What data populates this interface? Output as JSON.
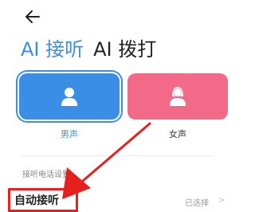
{
  "header": {
    "back_icon": "arrow-left-icon"
  },
  "tabs": [
    {
      "label": "AI 接听",
      "active": true
    },
    {
      "label": "AI 拨打",
      "active": false
    }
  ],
  "voice_options": [
    {
      "label": "男声",
      "icon": "male-avatar-icon",
      "color": "#3a8ee6",
      "selected": true
    },
    {
      "label": "女声",
      "icon": "female-avatar-icon",
      "color": "#f26a87",
      "selected": false
    }
  ],
  "settings": {
    "section_label": "接听电话设置",
    "auto_answer": {
      "label": "自动接听",
      "value": "已选择",
      "chevron": "chevron-right-icon"
    }
  },
  "annotation": {
    "color": "#e5201d"
  }
}
